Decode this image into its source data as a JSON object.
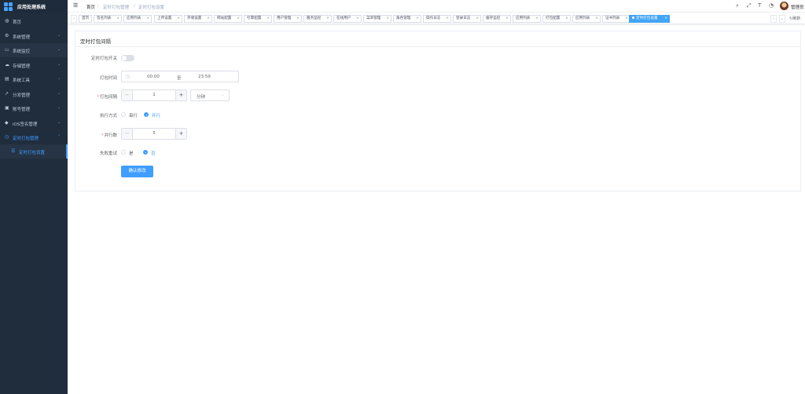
{
  "app": {
    "title": "应用处理系统"
  },
  "sidebar": {
    "items": [
      {
        "label": "首页",
        "icon": "dashboard-icon",
        "glyph": "◍"
      },
      {
        "label": "系统管理",
        "icon": "gear-icon",
        "glyph": "⚙"
      },
      {
        "label": "系统监控",
        "icon": "monitor-icon",
        "glyph": "▭"
      },
      {
        "label": "存储管理",
        "icon": "cloud-icon",
        "glyph": "☁"
      },
      {
        "label": "系统工具",
        "icon": "tool-icon",
        "glyph": "▤"
      },
      {
        "label": "分发管理",
        "icon": "share-icon",
        "glyph": "↗"
      },
      {
        "label": "账号管理",
        "icon": "user-icon",
        "glyph": "▣"
      },
      {
        "label": "iOS签名管理",
        "icon": "apple-icon",
        "glyph": "◆"
      },
      {
        "label": "定时打包管理",
        "icon": "clock-icon",
        "glyph": "◷"
      }
    ],
    "submenu": {
      "label": "定时打包设置",
      "icon": "list-icon",
      "glyph": "☰"
    }
  },
  "navbar": {
    "breadcrumb": [
      "首页",
      "定时打包管理",
      "定时打包设置"
    ],
    "separator": "/",
    "username": "管理员",
    "icons": [
      "search-icon",
      "fullscreen-icon",
      "font-size-icon",
      "bell-icon"
    ]
  },
  "tags": {
    "items": [
      "首页",
      "签名列表",
      "应用列表",
      "上传设置",
      "存储设置",
      "网站配置",
      "引擎配置",
      "用户管理",
      "服务监控",
      "在线用户",
      "菜单管理",
      "角色管理",
      "操作日志",
      "登录日志",
      "缓存监控",
      "应用列表",
      "打包配置",
      "应用列表",
      "证书列表",
      "定时打包设置"
    ],
    "active_index": 19,
    "close_glyph": "×",
    "refresh_label": "刷新"
  },
  "form": {
    "title": "定时打包间隔",
    "switch_label": "定时打包开关",
    "switch_on": false,
    "time_label": "打包时间",
    "time_start": "00:00",
    "time_sep": "至",
    "time_end": "23:59",
    "interval_label": "打包间隔",
    "interval_value": "1",
    "interval_unit": "分钟",
    "mode_label": "执行方式",
    "mode_options": [
      "串行",
      "并行"
    ],
    "mode_selected": "并行",
    "parallel_label": "并行数",
    "parallel_value": "5",
    "retry_label": "失败重试",
    "retry_options": [
      "是",
      "否"
    ],
    "retry_selected": "否",
    "submit_label": "确认修改",
    "required_mark": "*"
  },
  "colors": {
    "primary": "#409eff",
    "sidebar_bg": "#1f2d3d",
    "active_tag": "#42a5f5"
  }
}
